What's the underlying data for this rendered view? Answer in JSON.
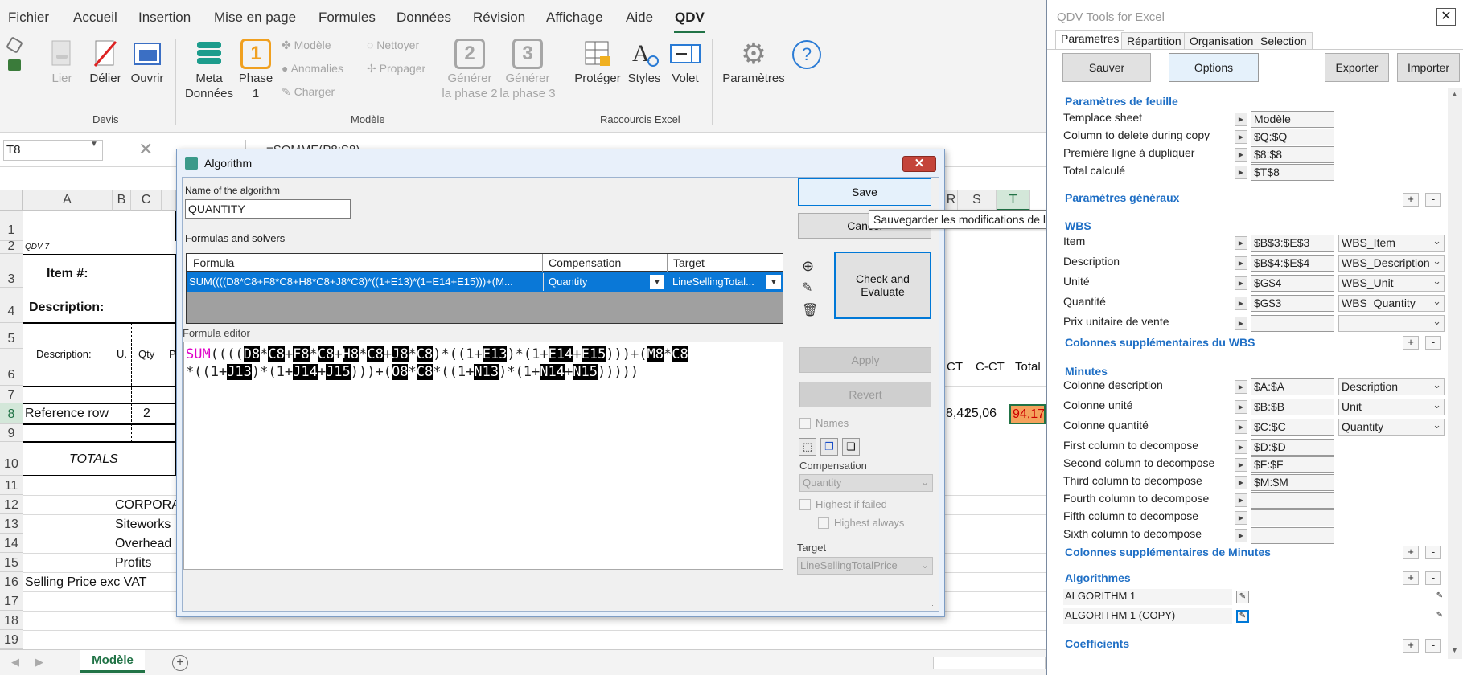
{
  "ribbon": {
    "tabs": [
      "Fichier",
      "Accueil",
      "Insertion",
      "Mise en page",
      "Formules",
      "Données",
      "Révision",
      "Affichage",
      "Aide",
      "QDV"
    ],
    "devis": {
      "label": "Devis",
      "lier": "Lier",
      "delier": "Délier",
      "ouvrir": "Ouvrir"
    },
    "modele": {
      "label": "Modèle",
      "meta1": "Meta",
      "meta2": "Données",
      "phase1": "Phase",
      "phase1b": "1",
      "phase_icon": "1",
      "modele": "Modèle",
      "anomalies": "Anomalies",
      "charger": "Charger",
      "nettoyer": "Nettoyer",
      "propager": "Propager",
      "gen2a": "Générer",
      "gen2b": "la phase 2",
      "gen3a": "Générer",
      "gen3b": "la phase 3",
      "icon2": "2",
      "icon3": "3"
    },
    "raccourcis": {
      "label": "Raccourcis Excel",
      "proteger": "Protéger",
      "styles": "Styles",
      "volet": "Volet"
    },
    "parametres": "Paramètres"
  },
  "formula_bar": {
    "namebox": "T8",
    "formula": "=SOMME(P8:S8)"
  },
  "sheet": {
    "columns": [
      "A",
      "B",
      "C",
      "R",
      "S",
      "T"
    ],
    "rows": [
      "1",
      "2",
      "3",
      "4",
      "5",
      "6",
      "7",
      "8",
      "9",
      "10",
      "11",
      "12",
      "13",
      "14",
      "15",
      "16",
      "17",
      "18",
      "19"
    ],
    "qdv": "QDV 7",
    "item": "Item #:",
    "description": "Description:",
    "desc_h": "Description:",
    "u_h": "U.",
    "qty_h": "Qty",
    "p_h": "P",
    "ct": "CT",
    "cct": "C-CT",
    "total": "Total",
    "ref": "Reference row",
    "ref_qty": "2",
    "r8": "8,41",
    "s8": "25,06",
    "t8": "94,17",
    "totals": "TOTALS",
    "corpora": "CORPORAT",
    "siteworks": "Siteworks",
    "overhead": "Overhead",
    "profits": "Profits",
    "selling": "Selling Price  exc VAT",
    "sheet_tab": "Modèle"
  },
  "dialog": {
    "title": "Algorithm",
    "name_label": "Name of the algorithm",
    "name_value": "QUANTITY",
    "formulas_label": "Formulas and solvers",
    "col_formula": "Formula",
    "col_comp": "Compensation",
    "col_target": "Target",
    "row_formula": "SUM((((D8*C8+F8*C8+H8*C8+J8*C8)*((1+E13)*(1+E14+E15)))+(M...",
    "row_comp": "Quantity",
    "row_target": "LineSellingTotal...",
    "editor_label": "Formula editor",
    "save": "Save",
    "cancel": "Cancel",
    "check": "Check and",
    "evaluate": "Evaluate",
    "tooltip": "Sauvegarder les modifications de l'algorithme et fermer",
    "apply": "Apply",
    "revert": "Revert",
    "names": "Names",
    "comp_label": "Compensation",
    "comp_value": "Quantity",
    "highest_failed": "Highest if failed",
    "highest_always": "Highest always",
    "target_label": "Target",
    "target_value": "LineSellingTotalPrice"
  },
  "pane": {
    "title": "QDV Tools for Excel",
    "tabs": [
      "Parametres",
      "Répartition",
      "Organisation",
      "Selection"
    ],
    "sauver": "Sauver",
    "options": "Options",
    "exporter": "Exporter",
    "importer": "Importer",
    "sec_feuille": "Paramètres de feuille",
    "template": "Templace sheet",
    "template_v": "Modèle",
    "coldel": "Column to delete during copy",
    "coldel_v": "$Q:$Q",
    "premiere": "Première ligne à dupliquer",
    "premiere_v": "$8:$8",
    "total": "Total calculé",
    "total_v": "$T$8",
    "sec_generaux": "Paramètres généraux",
    "wbs": "WBS",
    "item": "Item",
    "item_v": "$B$3:$E$3",
    "item_d": "WBS_Item",
    "desc": "Description",
    "desc_v": "$B$4:$E$4",
    "desc_d": "WBS_Description",
    "unite": "Unité",
    "unite_v": "$G$4",
    "unite_d": "WBS_Unit",
    "quantite": "Quantité",
    "quantite_v": "$G$3",
    "quantite_d": "WBS_Quantity",
    "prix": "Prix unitaire de vente",
    "sec_colwbs": "Colonnes supplémentaires du WBS",
    "sec_minutes": "Minutes",
    "cdesc": "Colonne description",
    "cdesc_v": "$A:$A",
    "cdesc_d": "Description",
    "cunite": "Colonne unité",
    "cunite_v": "$B:$B",
    "cunite_d": "Unit",
    "cqty": "Colonne quantité",
    "cqty_v": "$C:$C",
    "cqty_d": "Quantity",
    "first": "First column to decompose",
    "first_v": "$D:$D",
    "second": "Second column to decompose",
    "second_v": "$F:$F",
    "third": "Third column to decompose",
    "third_v": "$M:$M",
    "fourth": "Fourth column to decompose",
    "fifth": "Fifth column to decompose",
    "sixth": "Sixth column to decompose",
    "sec_colmin": "Colonnes supplémentaires de Minutes",
    "sec_algo": "Algorithmes",
    "algo1": "ALGORITHM 1",
    "algo2": "ALGORITHM 1 (COPY)",
    "sec_coef": "Coefficients"
  }
}
